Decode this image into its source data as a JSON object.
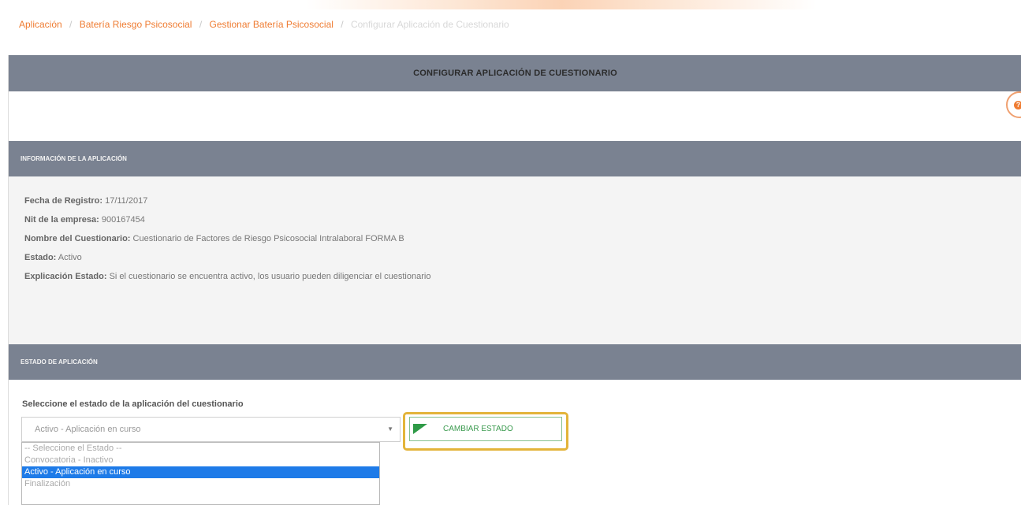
{
  "breadcrumb": {
    "items": [
      "Aplicación",
      "Batería Riesgo Psicosocial",
      "Gestionar Batería Psicosocial"
    ],
    "current": "Configurar Aplicación de Cuestionario",
    "separator": "/"
  },
  "panel": {
    "title": "CONFIGURAR APLICACIÓN DE CUESTIONARIO",
    "help_icon": "question-circle-icon"
  },
  "info": {
    "section_title": "INFORMACIÓN DE LA APLICACIÓN",
    "fecha_label": "Fecha de Registro:",
    "fecha_value": "17/11/2017",
    "nit_label": "Nit de la empresa:",
    "nit_value": "900167454",
    "nombre_label": "Nombre del Cuestionario:",
    "nombre_value": "Cuestionario de Factores de Riesgo Psicosocial Intralaboral FORMA B",
    "estado_label": "Estado:",
    "estado_value": "Activo",
    "explicacion_label": "Explicación Estado:",
    "explicacion_value": "Si el cuestionario se encuentra activo, los usuario pueden diligenciar el cuestionario"
  },
  "estado": {
    "section_title": "ESTADO DE APLICACIÓN",
    "select_label": "Seleccione el estado de la aplicación del cuestionario",
    "select_value": "Activo - Aplicación en curso",
    "options": [
      "-- Seleccione el Estado --",
      "Convocatoria - Inactivo",
      "Activo - Aplicación en curso",
      "Finalización"
    ],
    "selected_index": 2,
    "button_label": "CAMBIAR ESTADO"
  },
  "colors": {
    "accent": "#ef7c32",
    "header": "#7a8291",
    "highlight": "#e3b43a",
    "selected": "#1e7be8",
    "button": "#3a9a4e"
  }
}
